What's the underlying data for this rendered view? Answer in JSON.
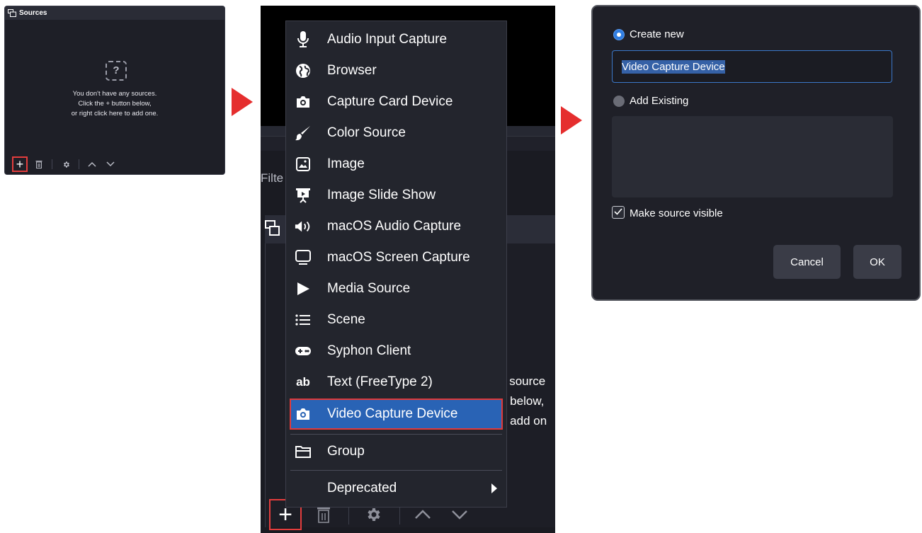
{
  "sources_dock": {
    "title": "Sources",
    "placeholder_icon": "question-mark-icon",
    "empty_line1": "You don't have any sources.",
    "empty_line2": "Click the + button below,",
    "empty_line3": "or right click here to add one.",
    "toolbar": {
      "add_label": "+",
      "icons": [
        "plus-icon",
        "trash-icon",
        "gear-icon",
        "chevron-up-icon",
        "chevron-down-icon"
      ]
    }
  },
  "arrow_color": "#e52e2e",
  "background_window": {
    "filter_fragment": "Filte",
    "empty_fragment1": "y source",
    "empty_fragment2": "n below,",
    "empty_fragment3": "o add on"
  },
  "add_source_menu": {
    "items": [
      {
        "label": "Audio Input Capture",
        "icon": "microphone-icon"
      },
      {
        "label": "Browser",
        "icon": "globe-icon"
      },
      {
        "label": "Capture Card Device",
        "icon": "camera-icon"
      },
      {
        "label": "Color Source",
        "icon": "paintbrush-icon"
      },
      {
        "label": "Image",
        "icon": "image-icon"
      },
      {
        "label": "Image Slide Show",
        "icon": "slideshow-icon"
      },
      {
        "label": "macOS Audio Capture",
        "icon": "speaker-icon"
      },
      {
        "label": "macOS Screen Capture",
        "icon": "monitor-icon"
      },
      {
        "label": "Media Source",
        "icon": "play-icon"
      },
      {
        "label": "Scene",
        "icon": "list-icon"
      },
      {
        "label": "Syphon Client",
        "icon": "gamepad-icon"
      },
      {
        "label": "Text (FreeType 2)",
        "icon": "text-ab-icon"
      },
      {
        "label": "Video Capture Device",
        "icon": "camera-icon",
        "selected": true
      },
      {
        "label": "Group",
        "icon": "folder-icon"
      },
      {
        "label": "Deprecated",
        "icon": "",
        "submenu": true
      }
    ],
    "selected_color": "#2963b5",
    "highlight_color": "#e03a3a"
  },
  "create_source_dialog": {
    "create_new_label": "Create new",
    "name_value": "Video Capture Device",
    "add_existing_label": "Add Existing",
    "make_visible_label": "Make source visible",
    "make_visible_checked": true,
    "cancel_label": "Cancel",
    "ok_label": "OK",
    "accent_color": "#2f7de1"
  }
}
